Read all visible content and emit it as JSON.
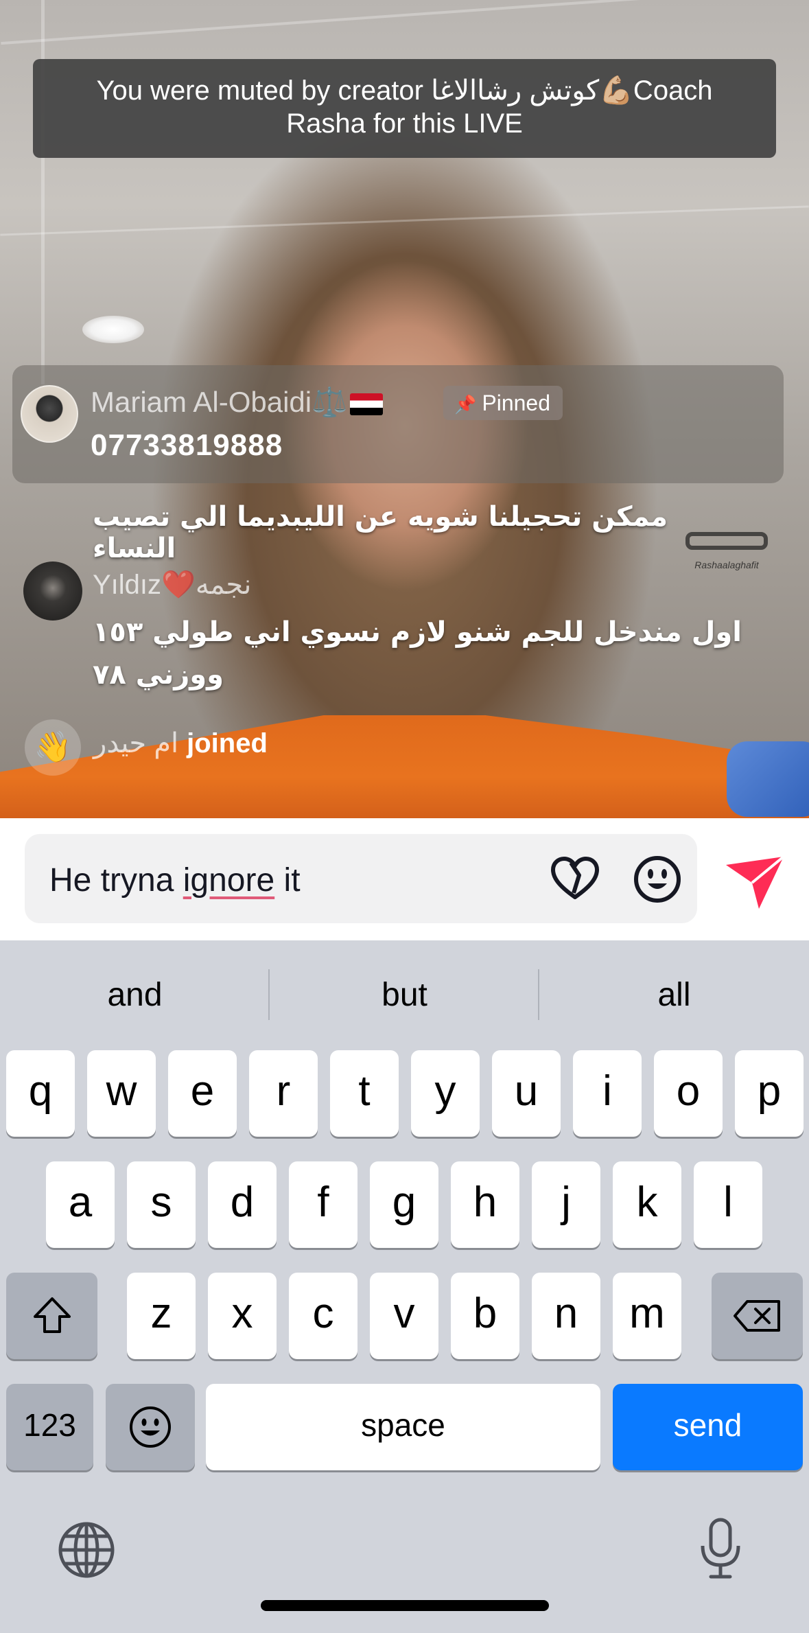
{
  "live": {
    "mute_banner": "You were muted by creator كوتش رشاالاغا💪🏼Coach Rasha for this LIVE",
    "pinned": {
      "user_name": "Mariam Al-Obaidi⚖️",
      "badge_label": "Pinned",
      "comment": "07733819888"
    },
    "comments": [
      {
        "text": "ممكن تحجيلنا شويه عن الليبديما الي تصيب النساء"
      },
      {
        "user": "Yıldız❤️نجمه",
        "text": "اول مندخل للجم شنو لازم نسوي اني طولي ١٥٣ ووزني ٧٨"
      }
    ],
    "join_event": {
      "user": "ام حيدر",
      "verb": "joined"
    },
    "studio_logo_text": "Rashaalaghafit"
  },
  "input": {
    "text_before": "He tryna ",
    "text_flagged": "ignore",
    "text_after": " it"
  },
  "keyboard": {
    "suggestions": [
      "and",
      "but",
      "all"
    ],
    "row1": [
      "q",
      "w",
      "e",
      "r",
      "t",
      "y",
      "u",
      "i",
      "o",
      "p"
    ],
    "row2": [
      "a",
      "s",
      "d",
      "f",
      "g",
      "h",
      "j",
      "k",
      "l"
    ],
    "row3": [
      "z",
      "x",
      "c",
      "v",
      "b",
      "n",
      "m"
    ],
    "numbers_key": "123",
    "space_key": "space",
    "send_key": "send"
  },
  "colors": {
    "send_accent": "#fe2c55",
    "keyboard_send": "#0a7aff",
    "flag_red": "#ce1126"
  }
}
